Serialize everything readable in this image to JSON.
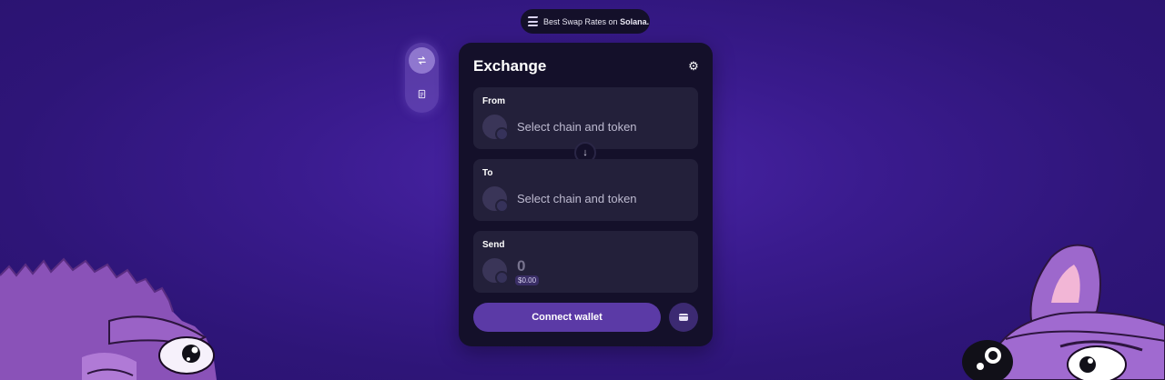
{
  "banner": {
    "prefix": "Best Swap Rates on",
    "highlight": "Solana."
  },
  "side_nav": {
    "items": [
      {
        "icon": "swap-arrows-icon",
        "active": true
      },
      {
        "icon": "document-icon",
        "active": false
      }
    ]
  },
  "exchange": {
    "title": "Exchange",
    "from": {
      "label": "From",
      "placeholder": "Select chain and token"
    },
    "to": {
      "label": "To",
      "placeholder": "Select chain and token"
    },
    "send": {
      "label": "Send",
      "amount": "0",
      "usd": "$0.00"
    },
    "connect_label": "Connect wallet"
  },
  "colors": {
    "card": "#14102a",
    "panel": "#23203a",
    "accent": "#5b3aa6",
    "background": "#3a1b8e"
  }
}
